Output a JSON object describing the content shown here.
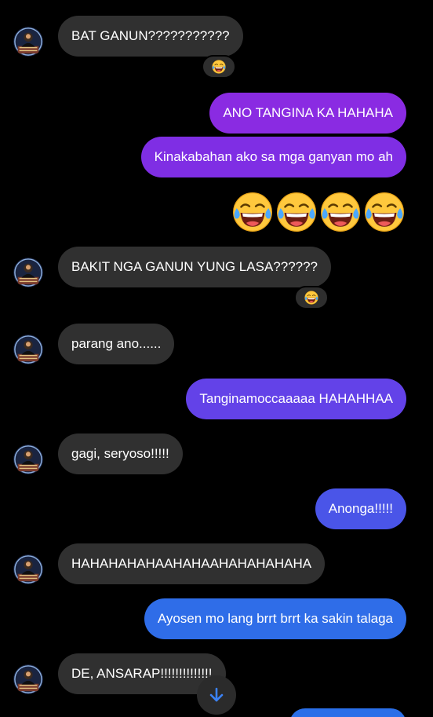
{
  "colors": {
    "background": "#000000",
    "incoming_bubble": "#303030",
    "outgoing_purple": "#8a2be2",
    "outgoing_indigo": "#6342e8",
    "outgoing_blue": "#2f6de8",
    "text": "#ffffff",
    "reaction_bg": "#2e2e2e",
    "scroll_arrow": "#3b82f6"
  },
  "messages": [
    {
      "id": "m1",
      "direction": "incoming",
      "text": "BAT GANUN???????????",
      "reaction": "laughing-tears-icon"
    },
    {
      "id": "m2",
      "direction": "outgoing",
      "text": "ANO TANGINA KA HAHAHA"
    },
    {
      "id": "m3",
      "direction": "outgoing",
      "text": "Kinakabahan ako sa mga ganyan mo ah"
    },
    {
      "id": "m4",
      "direction": "outgoing",
      "text": "",
      "emoji": "laughing-tears-icon",
      "emoji_count": 4
    },
    {
      "id": "m5",
      "direction": "incoming",
      "text": "BAKIT NGA GANUN YUNG LASA??????",
      "reaction": "laughing-tears-icon"
    },
    {
      "id": "m6",
      "direction": "incoming",
      "text": "parang ano......"
    },
    {
      "id": "m7",
      "direction": "outgoing",
      "text": "Tanginamoccaaaaa HAHAHHAA"
    },
    {
      "id": "m8",
      "direction": "incoming",
      "text": "gagi, seryoso!!!!!"
    },
    {
      "id": "m9",
      "direction": "outgoing",
      "text": "Anonga!!!!!"
    },
    {
      "id": "m10",
      "direction": "incoming",
      "text": "HAHAHAHAHAAHAHAAHAHAHAHAHA"
    },
    {
      "id": "m11",
      "direction": "outgoing",
      "text": "Ayosen mo lang brrt brrt ka sakin talaga"
    },
    {
      "id": "m12",
      "direction": "incoming",
      "text": "DE, ANSARAP!!!!!!!!!!!!!!"
    }
  ],
  "scroll_button": {
    "icon": "arrow-down-icon"
  }
}
